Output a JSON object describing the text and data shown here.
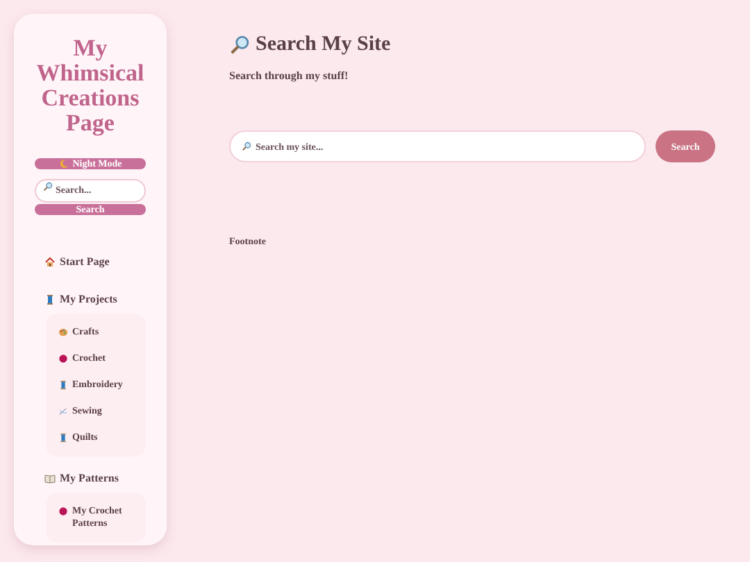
{
  "sidebar": {
    "title": "My Whimsical Creations Page",
    "night_mode_button": "Night Mode",
    "search": {
      "placeholder": "Search..."
    },
    "search_button": "Search",
    "nav": [
      {
        "label": "Start Page",
        "kind": "house"
      },
      {
        "label": "My Projects",
        "kind": "spool",
        "children": [
          {
            "label": "Crafts",
            "kind": "palette"
          },
          {
            "label": "Crochet",
            "kind": "yarn"
          },
          {
            "label": "Embroidery",
            "kind": "spool"
          },
          {
            "label": "Sewing",
            "kind": "needle"
          },
          {
            "label": "Quilts",
            "kind": "spool"
          }
        ]
      },
      {
        "label": "My Patterns",
        "kind": "book",
        "children": [
          {
            "label": "My Crochet Patterns",
            "kind": "yarn"
          }
        ]
      }
    ]
  },
  "main": {
    "title": "Search My Site",
    "subtitle": "Search through my stuff!",
    "search": {
      "placeholder": "Search my site..."
    },
    "search_button": "Search",
    "footnote": "Footnote"
  }
}
